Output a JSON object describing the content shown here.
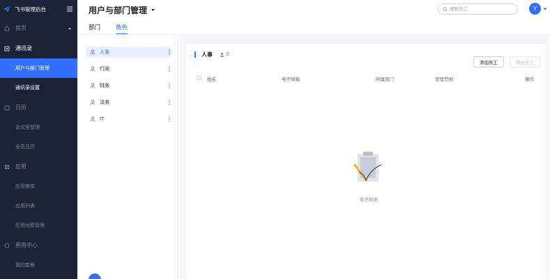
{
  "sidebar": {
    "brand": "飞书管理后台",
    "groups": [
      {
        "label": "首页",
        "items": []
      },
      {
        "label": "通讯录",
        "items": [
          "用户与部门管理",
          "通讯录设置"
        ]
      },
      {
        "label": "日历",
        "items": [
          "会议室管理",
          "全员日历"
        ]
      },
      {
        "label": "应用",
        "items": [
          "应用审核",
          "应用列表",
          "应用付费管理"
        ]
      },
      {
        "label": "费用中心",
        "items": [
          "我的套餐"
        ]
      }
    ]
  },
  "header": {
    "title": "用户与部门管理",
    "tabs": [
      "部门",
      "角色"
    ],
    "search_placeholder": "搜索员工",
    "avatar_letter": "Y"
  },
  "roles": [
    "人事",
    "行政",
    "财务",
    "法务",
    "IT"
  ],
  "main": {
    "role_title": "人事",
    "member_count": "0",
    "add_button": "添加员工",
    "export_button": "移出员工",
    "columns": [
      "姓名",
      "电子邮箱",
      "所属部门",
      "管理范围",
      "操作"
    ],
    "empty_text": "暂无数据"
  },
  "colors": {
    "accent": "#3370ff",
    "sidebar_bg": "#1b2337"
  }
}
